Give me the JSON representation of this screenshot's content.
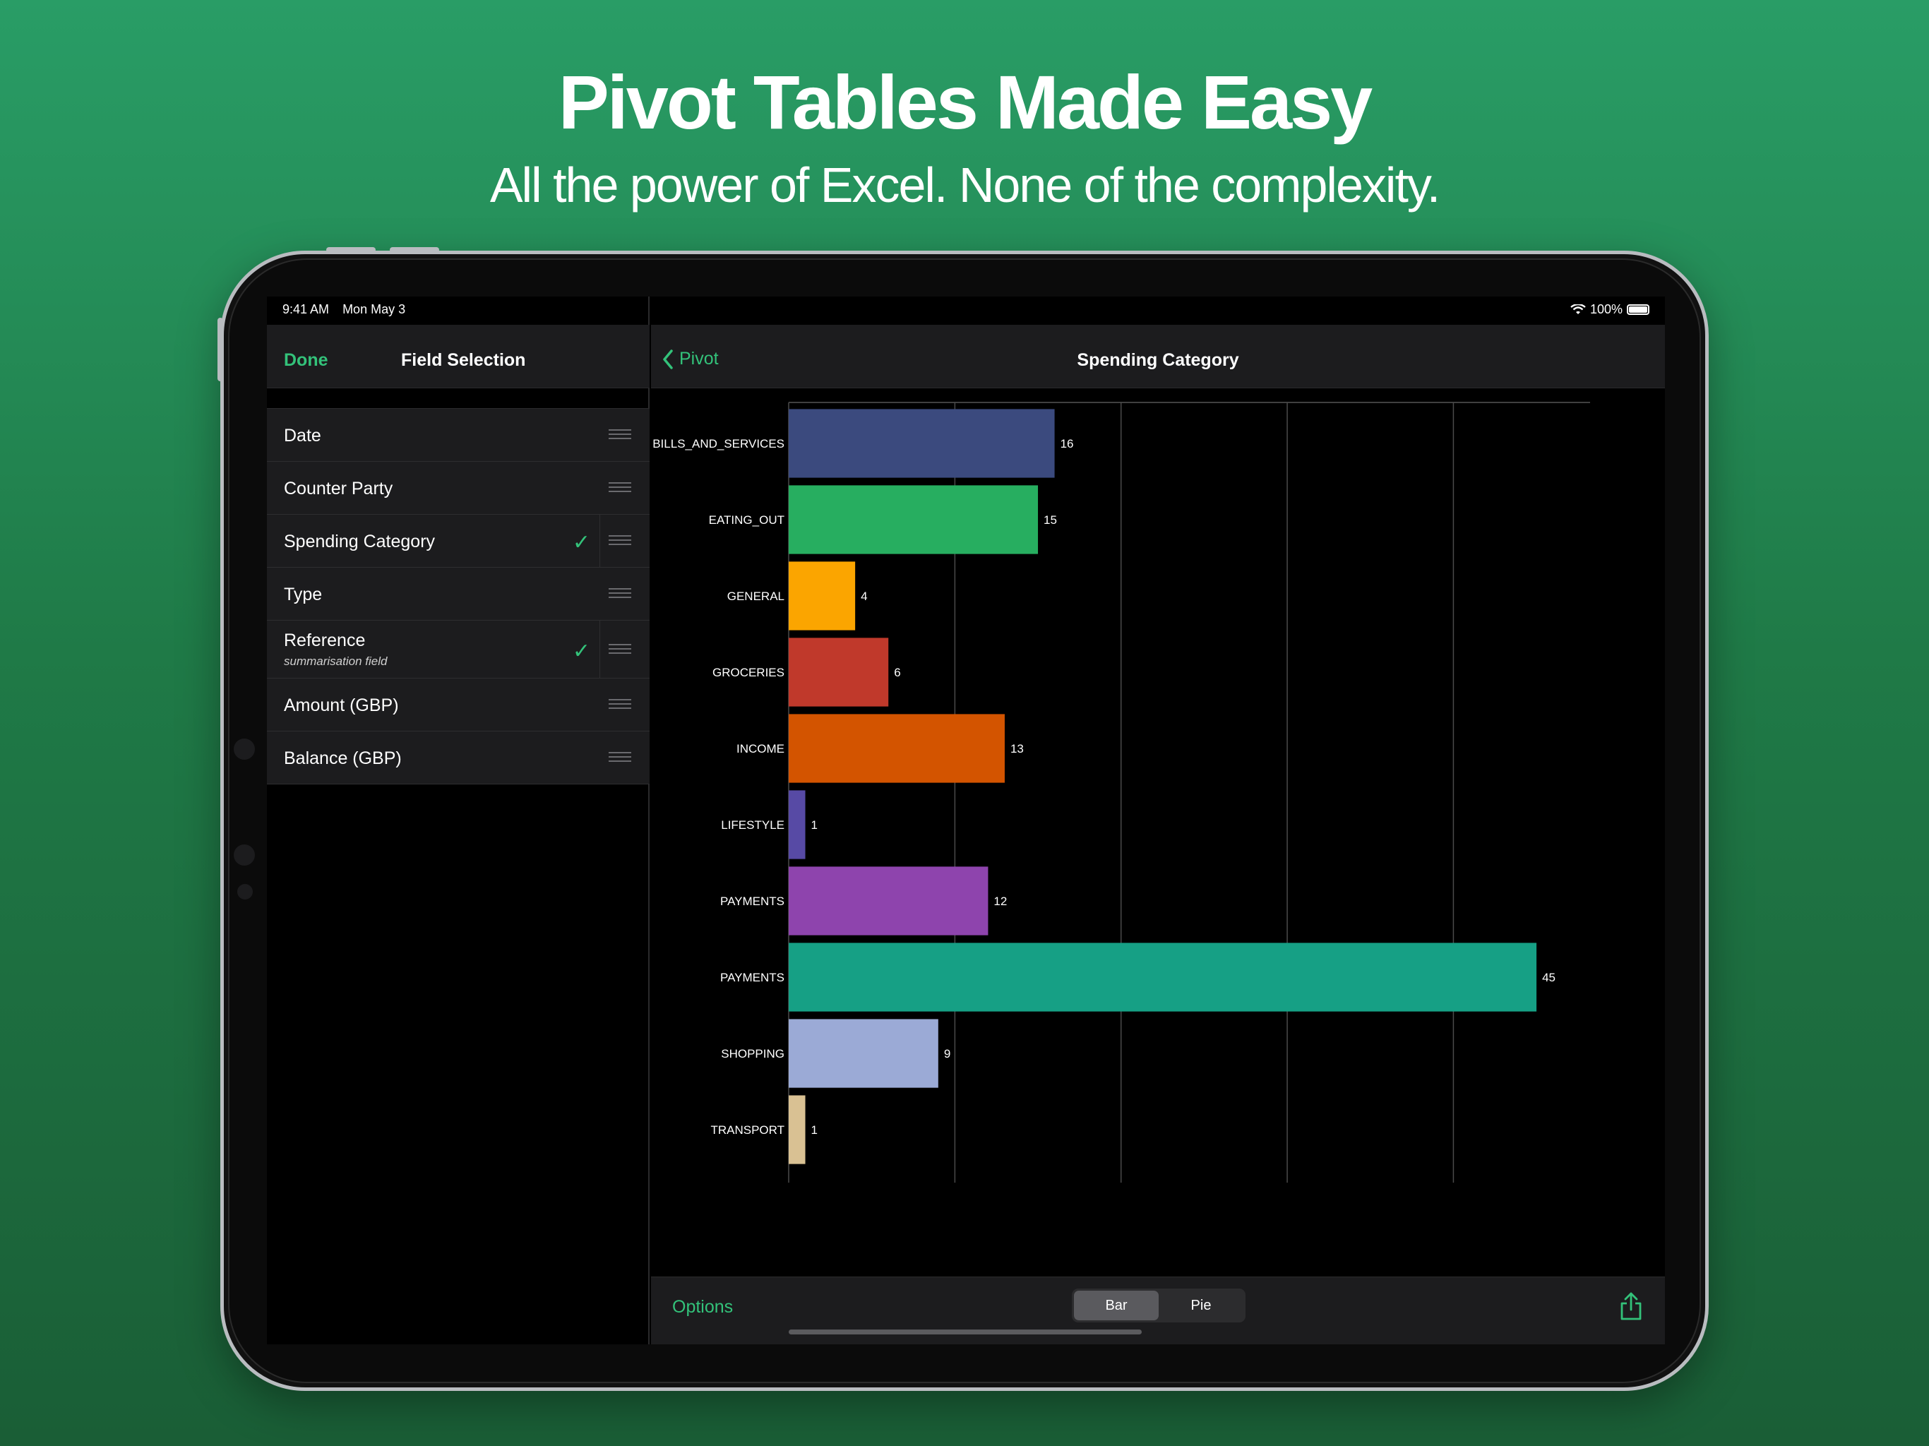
{
  "hero": {
    "title": "Pivot Tables Made Easy",
    "subtitle": "All the power of Excel. None of the complexity."
  },
  "status_bar": {
    "time": "9:41 AM",
    "date": "Mon May 3",
    "battery": "100%"
  },
  "left_panel": {
    "done_label": "Done",
    "title": "Field Selection",
    "fields": [
      {
        "label": "Date",
        "sub": "",
        "checked": false
      },
      {
        "label": "Counter Party",
        "sub": "",
        "checked": false
      },
      {
        "label": "Spending Category",
        "sub": "",
        "checked": true
      },
      {
        "label": "Type",
        "sub": "",
        "checked": false
      },
      {
        "label": "Reference",
        "sub": "summarisation field",
        "checked": true
      },
      {
        "label": "Amount (GBP)",
        "sub": "",
        "checked": false
      },
      {
        "label": "Balance (GBP)",
        "sub": "",
        "checked": false
      }
    ]
  },
  "right_panel": {
    "back_label": "Pivot",
    "title": "Spending Category",
    "options_label": "Options",
    "segments": [
      "Bar",
      "Pie"
    ],
    "selected_segment": "Bar"
  },
  "chart_data": {
    "type": "bar",
    "orientation": "horizontal",
    "categories": [
      "BILLS_AND_SERVICES",
      "EATING_OUT",
      "GENERAL",
      "GROCERIES",
      "INCOME",
      "LIFESTYLE",
      "PAYMENTS",
      "PAYMENTS",
      "SHOPPING",
      "TRANSPORT"
    ],
    "values": [
      16,
      15,
      4,
      6,
      13,
      1,
      12,
      45,
      9,
      1
    ],
    "colors": [
      "#3b4a7e",
      "#27ae60",
      "#fba500",
      "#c0392b",
      "#d35400",
      "#574aa5",
      "#8e44ad",
      "#16a085",
      "#9baad6",
      "#d9c193"
    ],
    "xlim": [
      0,
      49.5
    ],
    "gridlines_at": [
      10,
      20,
      30,
      40
    ],
    "grid": true
  }
}
